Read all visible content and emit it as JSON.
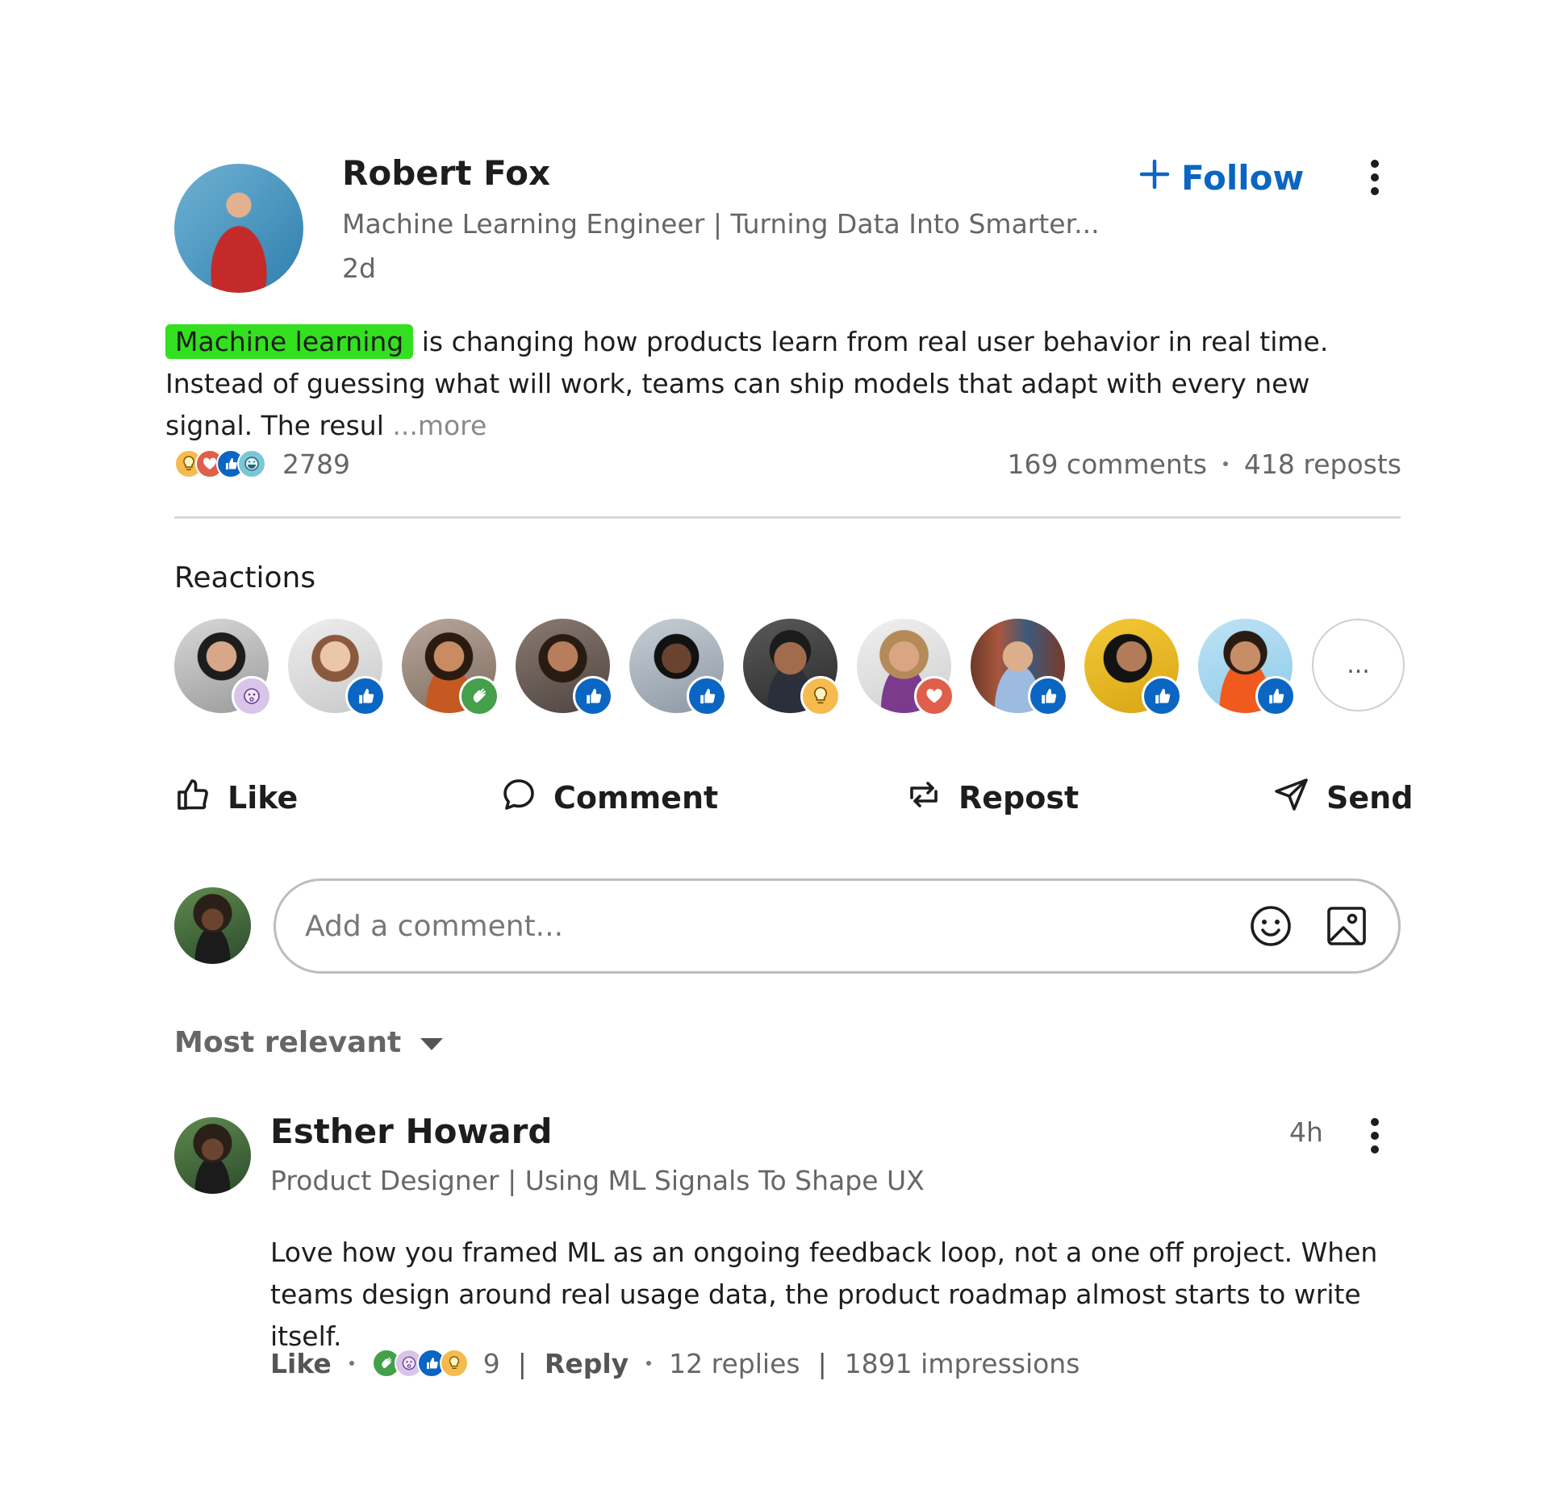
{
  "post": {
    "author": {
      "name": "Robert Fox",
      "headline": "Machine Learning Engineer | Turning Data Into Smarter...",
      "time": "2d"
    },
    "follow_label": "Follow",
    "text_highlight": "Machine learning",
    "text_body": " is changing how products learn from real user behavior in real time. Instead of guessing what will work, teams can ship models that adapt with every new signal. The resul ",
    "more_label": "...more",
    "reaction_count": "2789",
    "comments_count": "169 comments",
    "reposts_count": "418 reposts"
  },
  "reactions": {
    "title": "Reactions",
    "more_label": "...",
    "people": [
      {
        "reaction": "love-curious",
        "badge_color": "#d9c4ea"
      },
      {
        "reaction": "like",
        "badge_color": "#0a66c2"
      },
      {
        "reaction": "celebrate",
        "badge_color": "#44a04a"
      },
      {
        "reaction": "like",
        "badge_color": "#0a66c2"
      },
      {
        "reaction": "like",
        "badge_color": "#0a66c2"
      },
      {
        "reaction": "insightful",
        "badge_color": "#f5bb4e"
      },
      {
        "reaction": "love",
        "badge_color": "#df5f4a"
      },
      {
        "reaction": "like",
        "badge_color": "#0a66c2"
      },
      {
        "reaction": "like",
        "badge_color": "#0a66c2"
      },
      {
        "reaction": "like",
        "badge_color": "#0a66c2"
      }
    ]
  },
  "actions": {
    "like": "Like",
    "comment": "Comment",
    "repost": "Repost",
    "send": "Send"
  },
  "composer": {
    "placeholder": "Add a comment..."
  },
  "sort": {
    "label": "Most relevant"
  },
  "comment": {
    "name": "Esther Howard",
    "headline": "Product Designer | Using ML Signals To Shape UX",
    "time": "4h",
    "text": "Love how you framed ML as an ongoing feedback loop, not a one off project. When teams design around real usage data, the product roadmap almost starts to write itself.",
    "like_label": "Like",
    "reaction_count": "9",
    "reply_label": "Reply",
    "replies": "12 replies",
    "impressions": "1891 impressions"
  },
  "colors": {
    "brand_blue": "#0a66c2",
    "highlight_green": "#33e01f",
    "muted_text": "#666666"
  }
}
